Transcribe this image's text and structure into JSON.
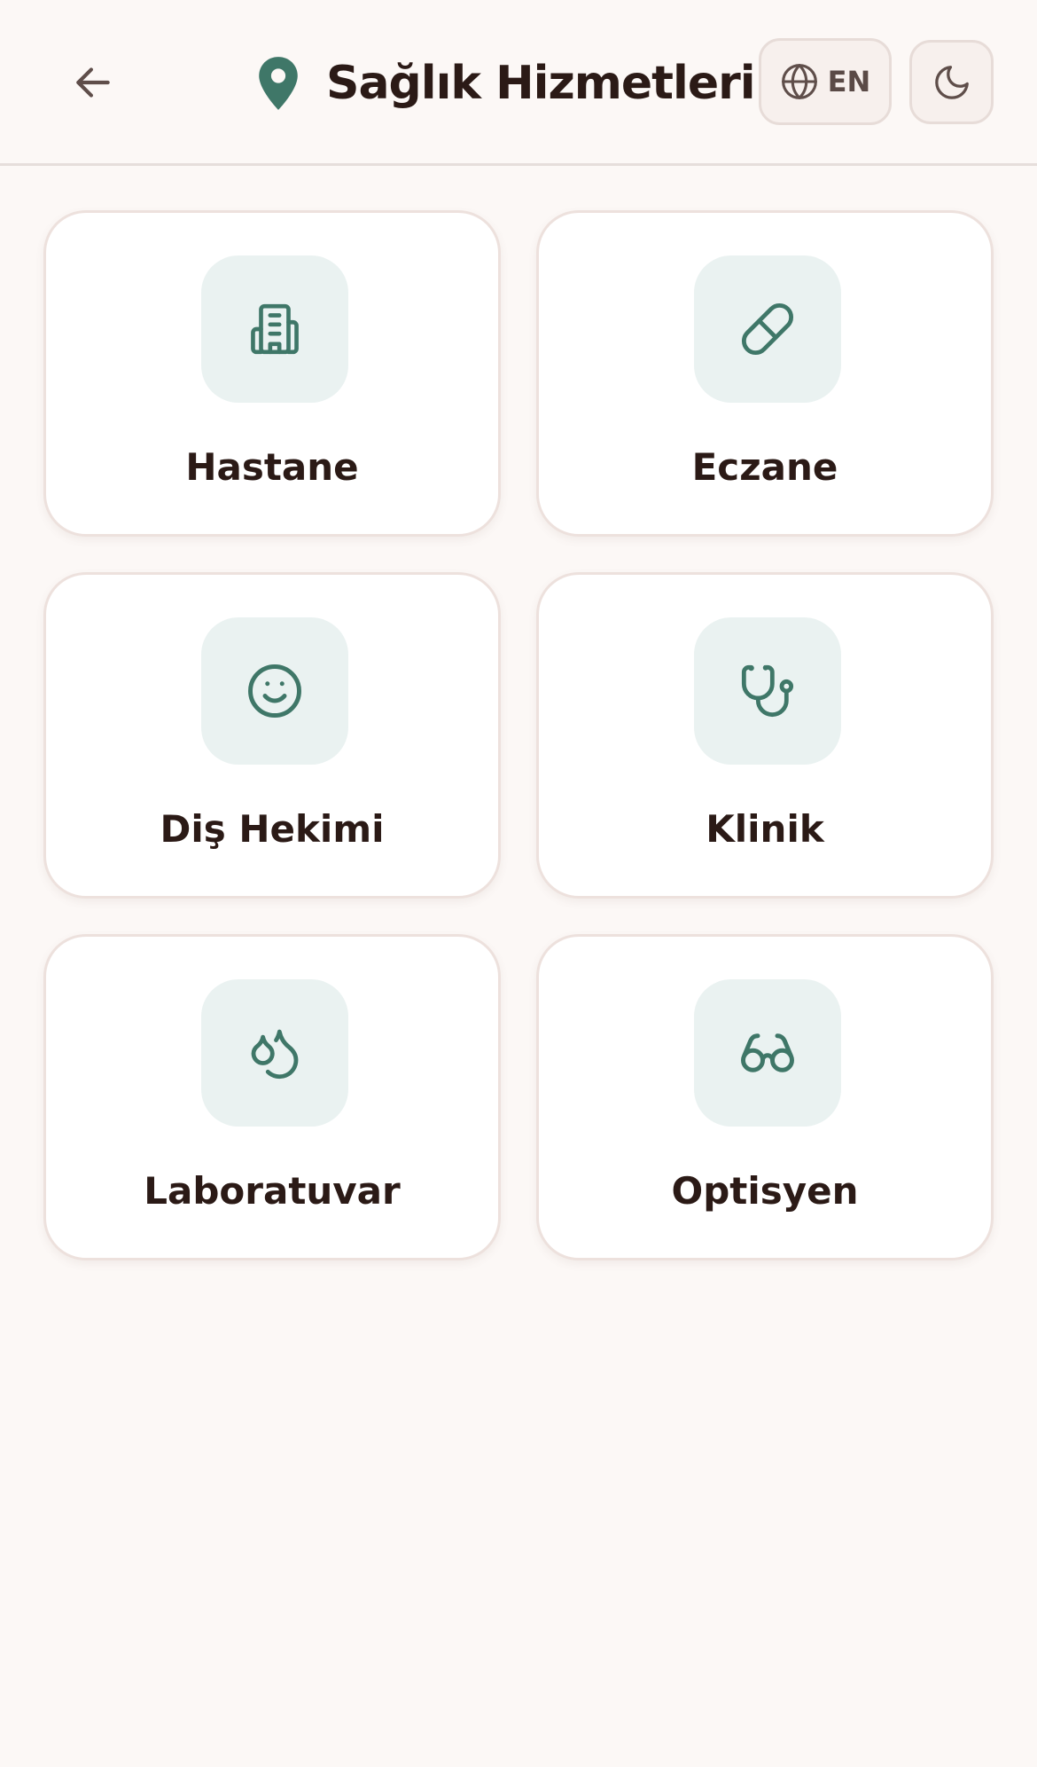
{
  "header": {
    "back_icon": "arrow-left-icon",
    "pin_icon": "map-pin-icon",
    "title": "Sağlık Hizmetleri",
    "lang_icon": "globe-icon",
    "lang_label": "EN",
    "theme_icon": "moon-icon"
  },
  "colors": {
    "accent": "#3f7768",
    "background": "#fcf8f6",
    "tile_bg": "#eaf2f1",
    "text": "#2b1a16"
  },
  "categories": [
    {
      "label": "Hastane",
      "icon": "building-icon"
    },
    {
      "label": "Eczane",
      "icon": "pill-icon"
    },
    {
      "label": "Diş Hekimi",
      "icon": "smile-icon"
    },
    {
      "label": "Klinik",
      "icon": "stethoscope-icon"
    },
    {
      "label": "Laboratuvar",
      "icon": "droplets-icon"
    },
    {
      "label": "Optisyen",
      "icon": "glasses-icon"
    }
  ]
}
